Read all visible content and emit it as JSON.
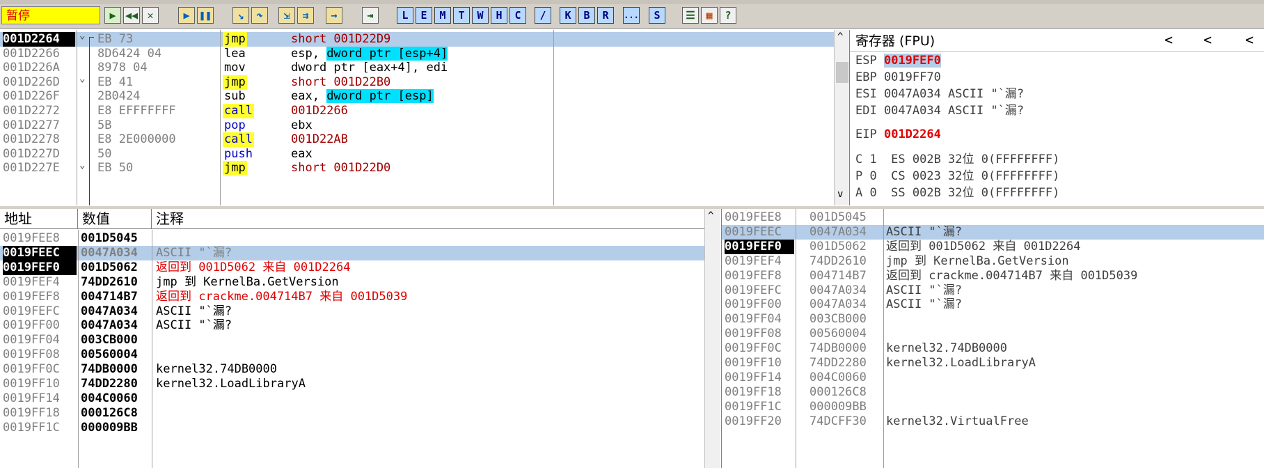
{
  "toolbar": {
    "status": "暂停",
    "letter_buttons": [
      "L",
      "E",
      "M",
      "T",
      "W",
      "H",
      "C",
      "/",
      "K",
      "B",
      "R",
      "...",
      "S"
    ]
  },
  "cpu": {
    "rows": [
      {
        "addr": "001D2264",
        "hex": "EB 73",
        "mnem": "jmp",
        "op": "short 001D22D9",
        "sel": true
      },
      {
        "addr": "001D2266",
        "hex": "8D6424 04",
        "mnem": "lea",
        "op": "esp, ",
        "op2": "dword ptr [esp+4]"
      },
      {
        "addr": "001D226A",
        "hex": "8978 04",
        "mnem": "mov",
        "op": "dword ptr [eax+4], edi"
      },
      {
        "addr": "001D226D",
        "hex": "EB 41",
        "mnem": "jmp",
        "op": "short 001D22B0"
      },
      {
        "addr": "001D226F",
        "hex": "2B0424",
        "mnem": "sub",
        "op": "eax, ",
        "op2": "dword ptr [esp]"
      },
      {
        "addr": "001D2272",
        "hex": "E8 EFFFFFFF",
        "mnem": "call",
        "op": "001D2266"
      },
      {
        "addr": "001D2277",
        "hex": "5B",
        "mnem": "pop",
        "op": "ebx"
      },
      {
        "addr": "001D2278",
        "hex": "E8 2E000000",
        "mnem": "call",
        "op": "001D22AB"
      },
      {
        "addr": "001D227D",
        "hex": "50",
        "mnem": "push",
        "op": "eax"
      },
      {
        "addr": "001D227E",
        "hex": "EB 50",
        "mnem": "jmp",
        "op": "short 001D22D0"
      }
    ]
  },
  "registers": {
    "title": "寄存器 (FPU)",
    "esp": {
      "name": "ESP",
      "value": "0019FEF0"
    },
    "ebp": "EBP 0019FF70",
    "esi": "ESI 0047A034 ASCII \"`漏?",
    "edi": "EDI 0047A034 ASCII \"`漏?",
    "eip": {
      "name": "EIP",
      "value": "001D2264"
    },
    "flags": [
      "C 1  ES 002B 32位 0(FFFFFFFF)",
      "P 0  CS 0023 32位 0(FFFFFFFF)",
      "A 0  SS 002B 32位 0(FFFFFFFF)"
    ]
  },
  "dump": {
    "headers": [
      "地址",
      "数值",
      "注释"
    ],
    "rows": [
      {
        "addr": "0019FEE8",
        "val": "001D5045",
        "note": ""
      },
      {
        "addr": "0019FEEC",
        "val": "0047A034",
        "note": "ASCII \"`漏?",
        "sel": true
      },
      {
        "addr": "0019FEF0",
        "val": "001D5062",
        "note": "返回到 001D5062 来自 001D2264",
        "red": true,
        "cur": true
      },
      {
        "addr": "0019FEF4",
        "val": "74DD2610",
        "note": "jmp 到 KernelBa.GetVersion"
      },
      {
        "addr": "0019FEF8",
        "val": "004714B7",
        "note": "返回到 crackme.004714B7 来自 001D5039",
        "red": true
      },
      {
        "addr": "0019FEFC",
        "val": "0047A034",
        "note": "ASCII \"`漏?"
      },
      {
        "addr": "0019FF00",
        "val": "0047A034",
        "note": "ASCII \"`漏?"
      },
      {
        "addr": "0019FF04",
        "val": "003CB000",
        "note": ""
      },
      {
        "addr": "0019FF08",
        "val": "00560004",
        "note": ""
      },
      {
        "addr": "0019FF0C",
        "val": "74DB0000",
        "note": "kernel32.74DB0000"
      },
      {
        "addr": "0019FF10",
        "val": "74DD2280",
        "note": "kernel32.LoadLibraryA"
      },
      {
        "addr": "0019FF14",
        "val": "004C0060",
        "note": ""
      },
      {
        "addr": "0019FF18",
        "val": "000126C8",
        "note": ""
      },
      {
        "addr": "0019FF1C",
        "val": "000009BB",
        "note": ""
      }
    ]
  },
  "stack": {
    "rows": [
      {
        "addr": "0019FEE8",
        "val": "001D5045",
        "note": ""
      },
      {
        "addr": "0019FEEC",
        "val": "0047A034",
        "note": "ASCII \"`漏?",
        "sel": true
      },
      {
        "addr": "0019FEF0",
        "val": "001D5062",
        "note": "返回到 001D5062 来自 001D2264",
        "cur": true
      },
      {
        "addr": "0019FEF4",
        "val": "74DD2610",
        "note": "jmp 到 KernelBa.GetVersion"
      },
      {
        "addr": "0019FEF8",
        "val": "004714B7",
        "note": "返回到 crackme.004714B7 来自 001D5039"
      },
      {
        "addr": "0019FEFC",
        "val": "0047A034",
        "note": "ASCII \"`漏?"
      },
      {
        "addr": "0019FF00",
        "val": "0047A034",
        "note": "ASCII \"`漏?"
      },
      {
        "addr": "0019FF04",
        "val": "003CB000",
        "note": ""
      },
      {
        "addr": "0019FF08",
        "val": "00560004",
        "note": ""
      },
      {
        "addr": "0019FF0C",
        "val": "74DB0000",
        "note": "kernel32.74DB0000"
      },
      {
        "addr": "0019FF10",
        "val": "74DD2280",
        "note": "kernel32.LoadLibraryA"
      },
      {
        "addr": "0019FF14",
        "val": "004C0060",
        "note": ""
      },
      {
        "addr": "0019FF18",
        "val": "000126C8",
        "note": ""
      },
      {
        "addr": "0019FF1C",
        "val": "000009BB",
        "note": ""
      },
      {
        "addr": "0019FF20",
        "val": "74DCFF30",
        "note": "kernel32.VirtualFree"
      }
    ]
  }
}
